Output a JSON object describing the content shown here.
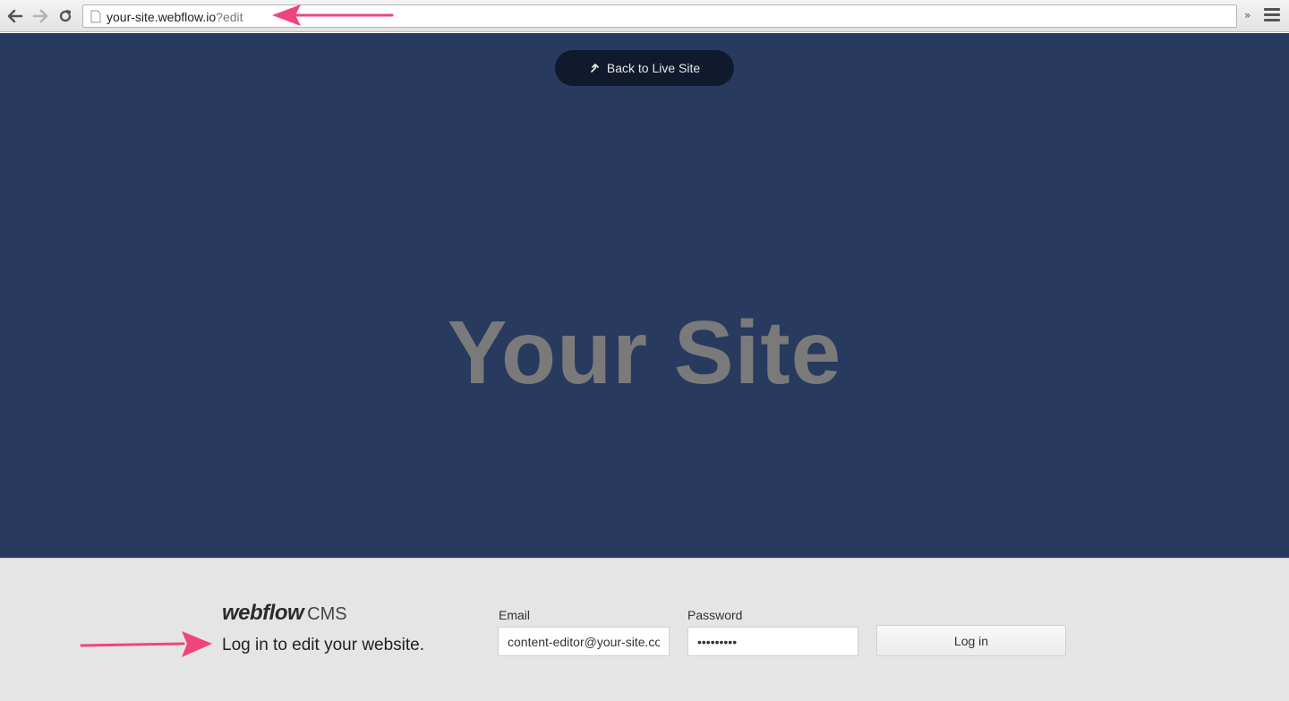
{
  "browser": {
    "url_host": "your-site.webflow.io",
    "url_query": "?edit",
    "extend_label": "»"
  },
  "hero": {
    "back_button_label": "Back to Live Site",
    "title": "Your Site",
    "background_color": "#283a5e"
  },
  "login": {
    "brand_logo": "webflow",
    "brand_suffix": "CMS",
    "tagline": "Log in to edit your website.",
    "email_label": "Email",
    "email_value": "content-editor@your-site.co",
    "password_label": "Password",
    "password_value": "•••••••••",
    "submit_label": "Log in"
  },
  "annotations": {
    "arrow_color": "#f0447a"
  }
}
